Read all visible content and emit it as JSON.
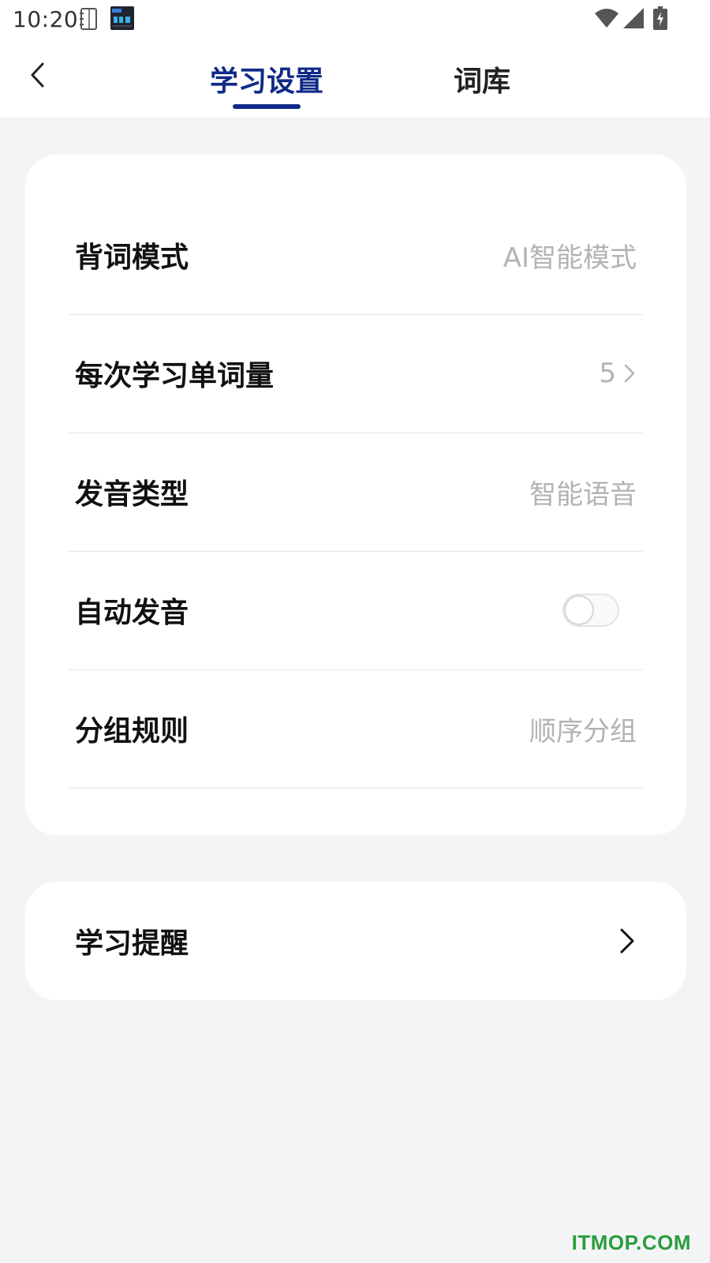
{
  "status_bar": {
    "time": "10:20",
    "icons": [
      "notebook-icon",
      "clock-app-icon",
      "wifi-icon",
      "signal-icon",
      "battery-charging-icon"
    ]
  },
  "header": {
    "back_icon": "chevron-left-icon",
    "tabs": [
      {
        "label": "学习设置",
        "active": true
      },
      {
        "label": "词库",
        "active": false
      }
    ]
  },
  "settings": {
    "rows": [
      {
        "label": "背词模式",
        "value": "AI智能模式"
      },
      {
        "label": "每次学习单词量",
        "value": "5"
      },
      {
        "label": "发音类型",
        "value": "智能语音"
      },
      {
        "label": "自动发音",
        "toggle_on": false
      },
      {
        "label": "分组规则",
        "value": "顺序分组"
      }
    ]
  },
  "reminder": {
    "label": "学习提醒"
  },
  "watermark": "ITMOP.COM",
  "colors": {
    "accent": "#0f2a87",
    "background": "#f3f4f6",
    "value_text": "#b3b3b3",
    "watermark": "#2a9d3d"
  }
}
